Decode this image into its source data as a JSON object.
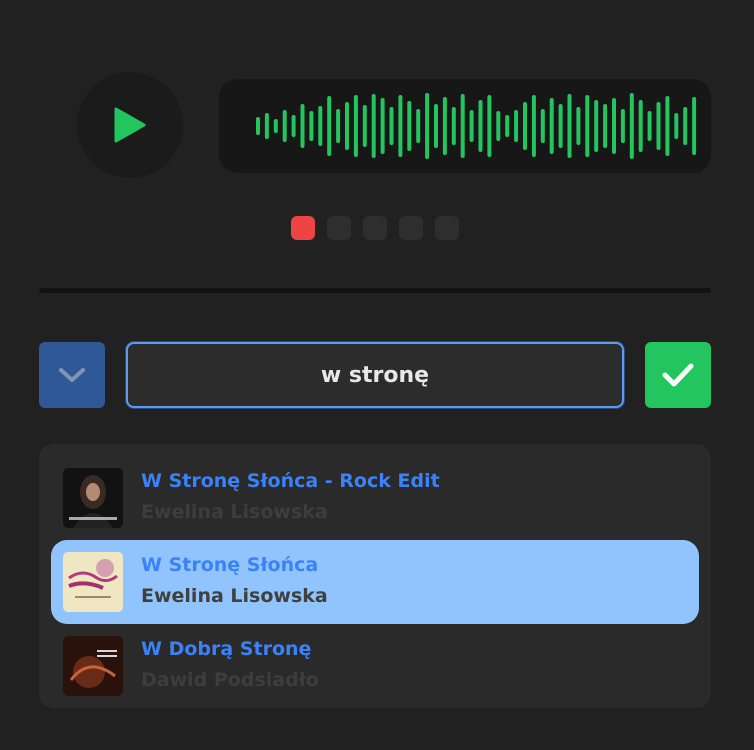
{
  "player": {
    "play_icon": "play-icon",
    "waveform_color": "#22c55e",
    "waveform_icon": "waveform-icon"
  },
  "attempts": {
    "total": 5,
    "used": 1,
    "active_color": "#ef4444"
  },
  "search": {
    "value": "w stronę",
    "expand_icon": "chevron-down-icon",
    "submit_icon": "check-icon"
  },
  "results": [
    {
      "title": "W Stronę Słońca - Rock Edit",
      "artist": "Ewelina Lisowska",
      "selected": false
    },
    {
      "title": "W Stronę Słońca",
      "artist": "Ewelina Lisowska",
      "selected": true
    },
    {
      "title": "W Dobrą Stronę",
      "artist": "Dawid Podsiadło",
      "selected": false
    }
  ],
  "colors": {
    "accent_blue": "#3b82f6",
    "selected_bg": "#91c4fd",
    "success": "#22c55e"
  }
}
